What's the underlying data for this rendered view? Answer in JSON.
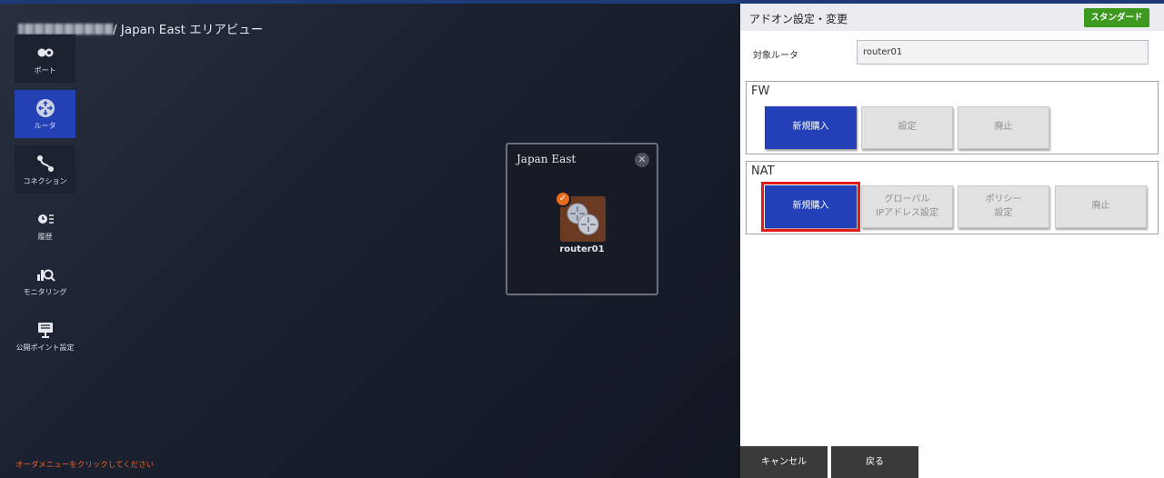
{
  "breadcrumb": {
    "region_view": "/ Japan East エリアビュー"
  },
  "nav": [
    {
      "label": "ポート",
      "icon": "port-icon"
    },
    {
      "label": "ルータ",
      "icon": "router-icon"
    },
    {
      "label": "コネクション",
      "icon": "connection-icon"
    },
    {
      "label": "履歴",
      "icon": "history-icon"
    },
    {
      "label": "モニタリング",
      "icon": "monitoring-icon"
    },
    {
      "label": "公開ポイント設定",
      "icon": "public-point-icon"
    }
  ],
  "region": {
    "title": "Japan East",
    "router_name": "router01"
  },
  "hint": "オーダメニューをクリックしてください",
  "panel": {
    "title": "アドオン設定・変更",
    "plan": "スタンダード",
    "target_label": "対象ルータ",
    "target_value": "router01",
    "fw": {
      "title": "FW",
      "buttons": [
        "新規購入",
        "設定",
        "廃止"
      ]
    },
    "nat": {
      "title": "NAT",
      "buttons": [
        "新規購入",
        "グローバル\nIPアドレス設定",
        "ポリシー\n設定",
        "廃止"
      ]
    },
    "cancel": "キャンセル",
    "back": "戻る"
  },
  "colors": {
    "primary": "#2340b8",
    "highlight": "#e31b1b",
    "plan_badge": "#3d9a1e",
    "hint": "#e8652a"
  }
}
